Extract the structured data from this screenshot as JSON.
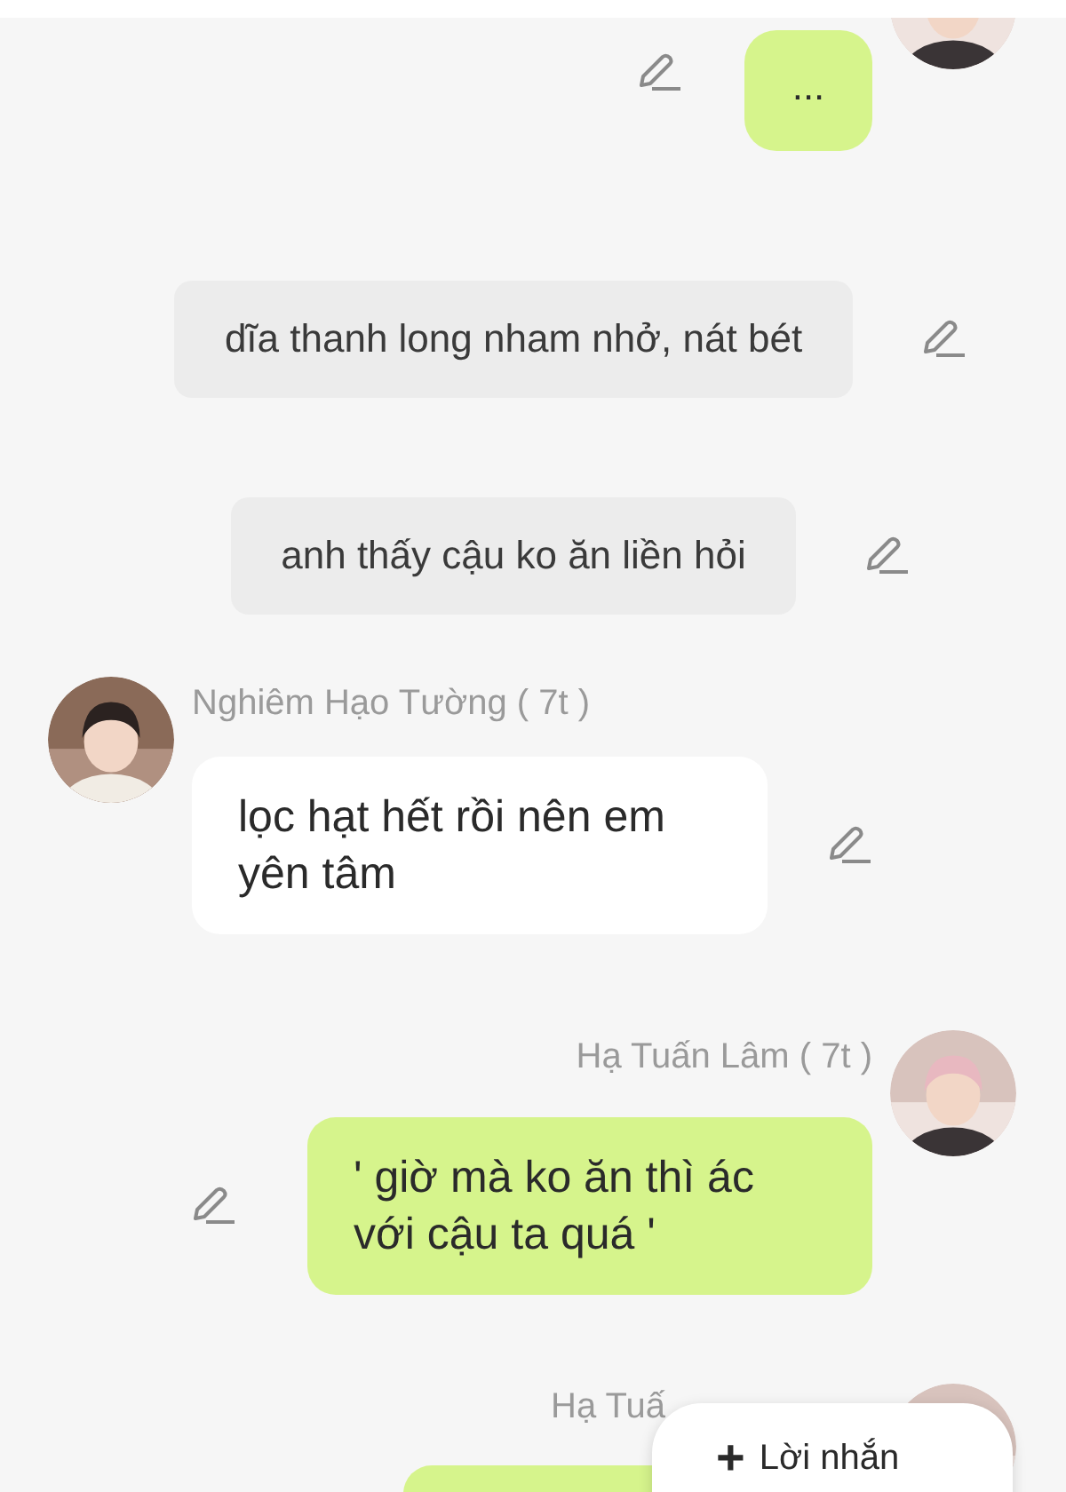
{
  "messages": [
    {
      "kind": "sent",
      "text": "..."
    },
    {
      "kind": "narration",
      "text": "dĩa thanh long nham nhở, nát bét"
    },
    {
      "kind": "narration",
      "text": "anh thấy cậu ko ăn liền hỏi"
    },
    {
      "kind": "received",
      "sender": "Nghiêm Hạo Tường ( 7t )",
      "text": "lọc hạt hết rồi nên em yên tâm"
    },
    {
      "kind": "sent",
      "sender": "Hạ Tuấn Lâm ( 7t )",
      "text": "' giờ mà ko ăn thì ác với cậu ta quá '"
    },
    {
      "kind": "sent",
      "sender": "Hạ Tuấ"
    }
  ],
  "fab": {
    "icon": "+",
    "label": "Lời nhắn"
  }
}
